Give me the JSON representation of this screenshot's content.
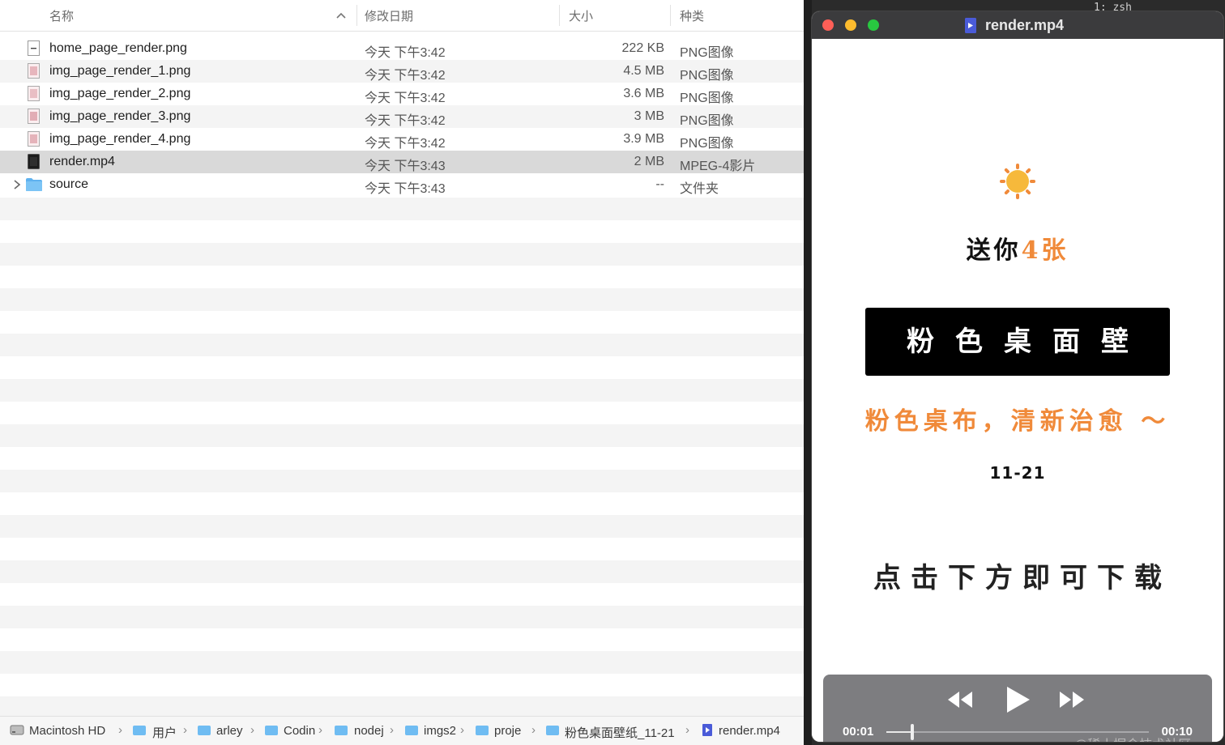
{
  "finder": {
    "columns": {
      "name": "名称",
      "date": "修改日期",
      "size": "大小",
      "kind": "种类"
    },
    "files": [
      {
        "name": "home_page_render.png",
        "date": "今天 下午3:42",
        "size": "222 KB",
        "kind": "PNG图像",
        "icon": "png-file-icon"
      },
      {
        "name": "img_page_render_1.png",
        "date": "今天 下午3:42",
        "size": "4.5 MB",
        "kind": "PNG图像",
        "icon": "png-file-icon"
      },
      {
        "name": "img_page_render_2.png",
        "date": "今天 下午3:42",
        "size": "3.6 MB",
        "kind": "PNG图像",
        "icon": "png-file-icon"
      },
      {
        "name": "img_page_render_3.png",
        "date": "今天 下午3:42",
        "size": "3 MB",
        "kind": "PNG图像",
        "icon": "png-file-icon"
      },
      {
        "name": "img_page_render_4.png",
        "date": "今天 下午3:42",
        "size": "3.9 MB",
        "kind": "PNG图像",
        "icon": "png-file-icon"
      },
      {
        "name": "render.mp4",
        "date": "今天 下午3:43",
        "size": "2 MB",
        "kind": "MPEG-4影片",
        "icon": "video-file-icon",
        "selected": true
      },
      {
        "name": "source",
        "date": "今天 下午3:43",
        "size": "--",
        "kind": "文件夹",
        "icon": "folder-icon",
        "folder": true
      }
    ],
    "path": [
      "Macintosh HD",
      "用户",
      "arley",
      "Codin",
      "nodej",
      "imgs2",
      "proje",
      "粉色桌面壁纸_11-21",
      "render.mp4"
    ]
  },
  "terminal": {
    "tab": "1: zsh"
  },
  "player": {
    "title": "render.mp4",
    "video": {
      "line1_prefix": "送你",
      "line1_accent": "4张",
      "banner": "粉色桌面壁纸",
      "tagline": "粉色桌布，清新治愈 ～",
      "date": "11-21",
      "cta": "点击下方即可下载"
    },
    "controls": {
      "current_time": "00:01",
      "total_time": "00:10",
      "progress": 0.1
    }
  },
  "watermark": "@稀土掘金技术社区",
  "colors": {
    "accent": "#f08a3a",
    "sun": "#f6b93b",
    "selection": "#d9d9d9"
  }
}
